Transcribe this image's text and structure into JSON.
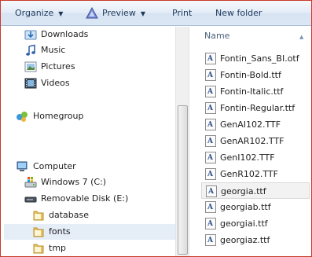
{
  "toolbar": {
    "organize": "Organize",
    "preview": "Preview",
    "print": "Print",
    "new_folder": "New folder"
  },
  "nav": {
    "favorites": [
      {
        "label": "Downloads",
        "icon": "downloads-icon"
      },
      {
        "label": "Music",
        "icon": "music-icon"
      },
      {
        "label": "Pictures",
        "icon": "pictures-icon"
      },
      {
        "label": "Videos",
        "icon": "videos-icon"
      }
    ],
    "homegroup": "Homegroup",
    "computer": "Computer",
    "drives": [
      {
        "label": "Windows 7 (C:)",
        "icon": "hard-drive-icon"
      },
      {
        "label": "Removable Disk (E:)",
        "icon": "removable-disk-icon"
      }
    ],
    "folders": [
      {
        "label": "database"
      },
      {
        "label": "fonts",
        "selected": true
      },
      {
        "label": "tmp"
      }
    ]
  },
  "files": {
    "column_name": "Name",
    "items": [
      "Fontin_Sans_BI.otf",
      "Fontin-Bold.ttf",
      "Fontin-Italic.ttf",
      "Fontin-Regular.ttf",
      "GenAI102.TTF",
      "GenAR102.TTF",
      "GenI102.TTF",
      "GenR102.TTF",
      "georgia.ttf",
      "georgiab.ttf",
      "georgiai.ttf",
      "georgiaz.ttf"
    ],
    "selected_index": 8,
    "file_icon_letter": "A"
  },
  "colors": {
    "selection": "#e5edf7",
    "frame_border": "#c83a2c",
    "toolbar_text": "#1e395b"
  }
}
